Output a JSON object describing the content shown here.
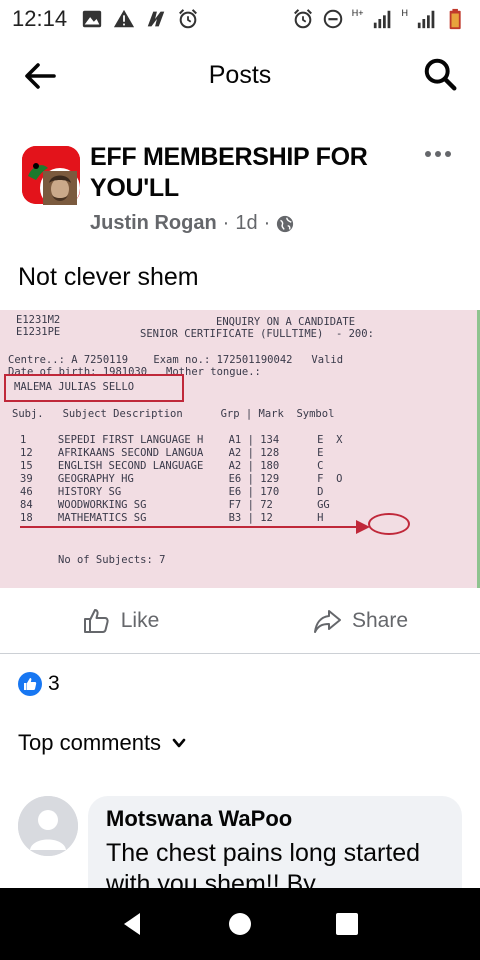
{
  "status_bar": {
    "time": "12:14",
    "left_icons": [
      "gallery-icon",
      "warning-icon",
      "n-icon",
      "alarm-icon"
    ],
    "right_icons": [
      "alarm-icon",
      "dnd-icon",
      "signal-icon",
      "signal-icon",
      "battery-icon"
    ],
    "network_label_1": "H+",
    "network_label_2": "H"
  },
  "header": {
    "title": "Posts",
    "back_icon": "arrow-left-icon",
    "search_icon": "search-icon"
  },
  "post": {
    "group_name": "EFF MEMBERSHIP FOR YOU'LL",
    "author": "Justin Rogan",
    "time": "1d",
    "separator": "·",
    "privacy_icon": "globe-icon",
    "text": "Not clever shem",
    "photo": {
      "line1_left": "E1231M2",
      "line1_right": "ENQUIRY ON A CANDIDATE",
      "line2_left": "E1231PE",
      "line2_right": "SENIOR CERTIFICATE (FULLTIME)  - 200:",
      "line3": "Centre..: A 7250119    Exam no.: 172501190042   Valid",
      "line4": "Date of birth: 1981030   Mother tongue.:",
      "name_boxed": "MALEMA JULIAS SELLO",
      "table_header": "Subj.   Subject Description      Grp | Mark  Symbol",
      "rows": [
        "1     SEPEDI FIRST LANGUAGE H    A1 | 134      E  X",
        "12    AFRIKAANS SECOND LANGUA    A2 | 128      E",
        "15    ENGLISH SECOND LANGUAGE    A2 | 180      C",
        "39    GEOGRAPHY HG               E6 | 129      F  O",
        "46    HISTORY SG                 E6 | 170      D",
        "84    WOODWORKING SG             F7 | 72       GG",
        "18    MATHEMATICS SG             B3 | 12       H"
      ],
      "footer": "No of Subjects: 7"
    }
  },
  "actions": {
    "like_label": "Like",
    "share_label": "Share"
  },
  "reactions": {
    "count": "3"
  },
  "comments": {
    "sort_label": "Top comments",
    "items": [
      {
        "name": "Motswana WaPoo",
        "text": "The chest pains long started with you shem!! By"
      }
    ]
  }
}
